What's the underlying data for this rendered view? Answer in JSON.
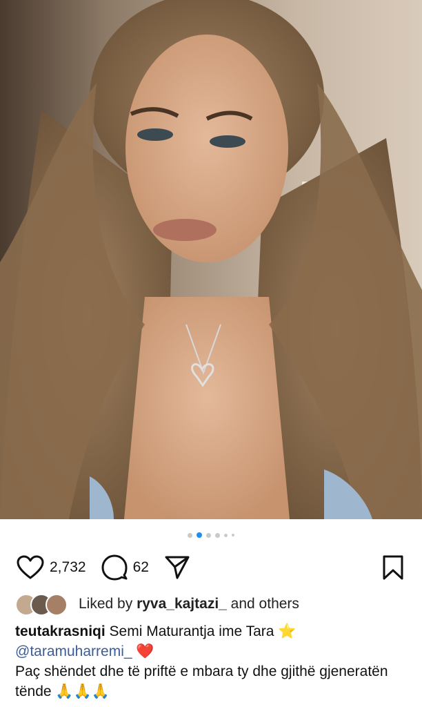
{
  "post": {
    "image_alt": "Selfie photo of a woman with long wavy light brown hair",
    "carousel": {
      "count": 6,
      "active_index": 1
    }
  },
  "actions": {
    "like_count": "2,732",
    "comment_count": "62"
  },
  "liked_by": {
    "prefix": "Liked by ",
    "user": "ryva_kajtazi_",
    "suffix": " and others"
  },
  "caption": {
    "username": "teutakrasniqi",
    "line1_text": " Semi Maturantja ime Tara ⭐",
    "mention_text": "@taramuharremi_",
    "heart": " ❤️",
    "line3": "Paç shëndet dhe të priftë e mbara ty dhe gjithë gjeneratën tënde 🙏🙏🙏"
  },
  "colors": {
    "accent_dot": "#1f8ef1",
    "mention": "#3b5c9a"
  }
}
